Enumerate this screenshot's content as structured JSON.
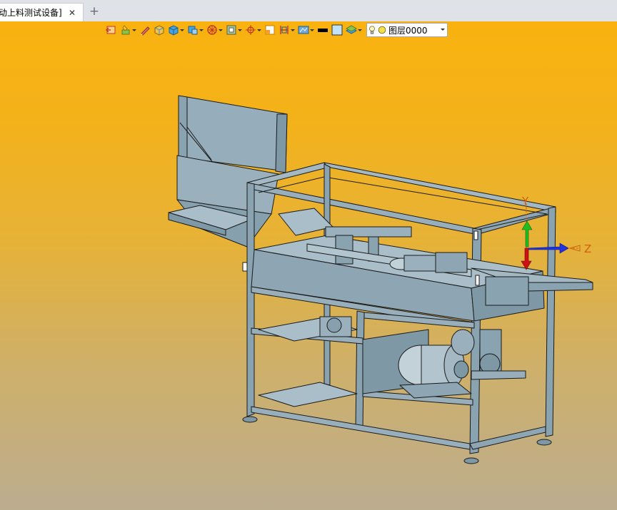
{
  "tabs": [
    {
      "label": "动上料测试设备]",
      "close_glyph": "✕"
    }
  ],
  "new_tab_glyph": "+",
  "toolbar": {
    "buttons": [
      {
        "icon": "exit-sketch-icon",
        "has_dropdown": false
      },
      {
        "icon": "sketch-paint-icon",
        "has_dropdown": true
      },
      {
        "icon": "pencil-icon",
        "has_dropdown": false
      },
      {
        "icon": "shaded-box-icon",
        "has_dropdown": false
      },
      {
        "icon": "blue-cube-icon",
        "has_dropdown": true
      },
      {
        "icon": "view-cube-icon",
        "has_dropdown": true
      },
      {
        "icon": "wheel-icon",
        "has_dropdown": true
      },
      {
        "icon": "frame-icon",
        "has_dropdown": true
      },
      {
        "icon": "crosshair-icon",
        "has_dropdown": true
      },
      {
        "icon": "section-icon",
        "has_dropdown": false
      },
      {
        "icon": "dimension-icon",
        "has_dropdown": true
      },
      {
        "icon": "render-icon",
        "has_dropdown": true
      },
      {
        "icon": "line-color-icon",
        "has_dropdown": false
      },
      {
        "icon": "face-color-icon",
        "has_dropdown": false
      },
      {
        "icon": "layers-icon",
        "has_dropdown": true
      }
    ],
    "layer_select": {
      "value": "图层0000"
    }
  },
  "axes": {
    "y_label": "Y",
    "z_label": "Z"
  },
  "colors": {
    "viewport_top": "#f9b20f",
    "viewport_bottom": "#bcad8f",
    "model_fill": "#93acb9",
    "model_edge": "#1a1a1a",
    "axis_y": "#22bb22",
    "axis_z": "#2233dd",
    "axis_x": "#cc1111",
    "axis_dashed": "#d06010"
  }
}
